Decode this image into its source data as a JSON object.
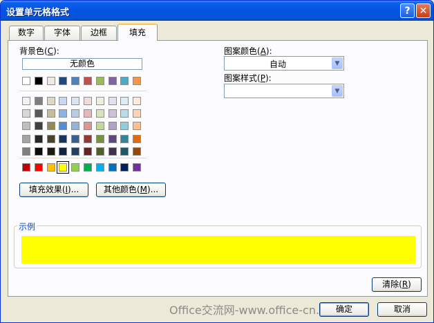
{
  "window": {
    "title": "设置单元格格式"
  },
  "titlebar": {
    "help": "?",
    "close": "✕"
  },
  "tabs": [
    {
      "label": "数字"
    },
    {
      "label": "字体"
    },
    {
      "label": "边框"
    },
    {
      "label": "填充"
    }
  ],
  "fill": {
    "bg_label_pre": "背景色(",
    "bg_label_key": "C",
    "bg_label_post": "):",
    "no_color": "无颜色",
    "selected_color": "#ffff00",
    "row_standard": [
      "#ffffff",
      "#000000",
      "#eeece1",
      "#1f497d",
      "#4f81bd",
      "#c0504d",
      "#9bbb59",
      "#8064a2",
      "#4bacc6",
      "#f79646"
    ],
    "theme_rows": [
      [
        "#f2f2f2",
        "#7f7f7f",
        "#ddd9c3",
        "#c6d9f0",
        "#dbe5f1",
        "#f2dcdb",
        "#ebf1dd",
        "#e5e0ec",
        "#dbeef3",
        "#fdeada"
      ],
      [
        "#d8d8d8",
        "#595959",
        "#c4bd97",
        "#8db3e2",
        "#b8cce4",
        "#e5b9b7",
        "#d7e3bc",
        "#ccc1d9",
        "#b7dde8",
        "#fbd5b5"
      ],
      [
        "#bfbfbf",
        "#3f3f3f",
        "#938953",
        "#548dd4",
        "#95b3d7",
        "#d99694",
        "#c3d69b",
        "#b2a2c7",
        "#92cddc",
        "#fac08f"
      ],
      [
        "#a5a5a5",
        "#262626",
        "#494429",
        "#17365d",
        "#366092",
        "#953734",
        "#76923c",
        "#5f497a",
        "#31859b",
        "#e36c09"
      ],
      [
        "#7f7f7f",
        "#0c0c0c",
        "#1d1b10",
        "#0f243e",
        "#244061",
        "#632423",
        "#4f6128",
        "#3f3151",
        "#205867",
        "#974806"
      ]
    ],
    "row_bright": [
      "#c00000",
      "#ff0000",
      "#ffc000",
      "#ffff00",
      "#92d050",
      "#00b050",
      "#00b0f0",
      "#0070c0",
      "#002060",
      "#7030a0"
    ],
    "fill_effects_pre": "填充效果(",
    "fill_effects_key": "I",
    "fill_effects_post": ")...",
    "more_colors_pre": "其他颜色(",
    "more_colors_key": "M",
    "more_colors_post": ")...",
    "pattern_color_pre": "图案颜色(",
    "pattern_color_key": "A",
    "pattern_color_post": "):",
    "pattern_color_value": "自动",
    "pattern_style_pre": "图案样式(",
    "pattern_style_key": "P",
    "pattern_style_post": "):",
    "pattern_style_value": "",
    "sample_label": "示例",
    "clear_pre": "清除(",
    "clear_key": "R",
    "clear_post": ")"
  },
  "footer": {
    "ok": "确定",
    "cancel": "取消",
    "watermark": "Office交流网-www.office-cn.net"
  }
}
